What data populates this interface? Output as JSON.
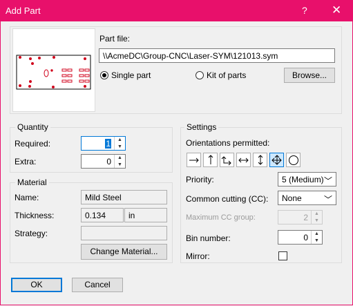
{
  "window": {
    "title": "Add Part",
    "help_glyph": "?",
    "close_glyph": "✕"
  },
  "part": {
    "label": "Part file:",
    "path": "\\\\AcmeDC\\Group-CNC\\Laser-SYM\\121013.sym",
    "single_part_label": "Single part",
    "kit_label": "Kit of parts",
    "mode": "single",
    "browse_label": "Browse..."
  },
  "quantity": {
    "title": "Quantity",
    "required_label": "Required:",
    "required_value": "1",
    "extra_label": "Extra:",
    "extra_value": "0"
  },
  "material": {
    "title": "Material",
    "name_label": "Name:",
    "name_value": "Mild Steel",
    "thickness_label": "Thickness:",
    "thickness_value": "0.134",
    "thickness_unit": "in",
    "strategy_label": "Strategy:",
    "strategy_value": "",
    "change_label": "Change Material..."
  },
  "settings": {
    "title": "Settings",
    "orientations_label": "Orientations permitted:",
    "orientations": [
      {
        "icon": "arrow-right-icon",
        "selected": false
      },
      {
        "icon": "arrow-up-icon",
        "selected": false
      },
      {
        "icon": "arrow-up-right-corner-icon",
        "selected": false
      },
      {
        "icon": "arrow-left-right-icon",
        "selected": false
      },
      {
        "icon": "arrow-up-down-icon",
        "selected": false
      },
      {
        "icon": "arrow-four-way-icon",
        "selected": true
      },
      {
        "icon": "circle-icon",
        "selected": false
      }
    ],
    "priority_label": "Priority:",
    "priority_value": "5 (Medium)",
    "cc_label": "Common cutting (CC):",
    "cc_value": "None",
    "max_cc_label": "Maximum CC group:",
    "max_cc_value": "2",
    "bin_label": "Bin number:",
    "bin_value": "0",
    "mirror_label": "Mirror:",
    "mirror_checked": false
  },
  "footer": {
    "ok_label": "OK",
    "cancel_label": "Cancel"
  },
  "colors": {
    "titlebar": "#e8106b",
    "accent": "#0078d7",
    "preview_marks": "#d0021b"
  }
}
